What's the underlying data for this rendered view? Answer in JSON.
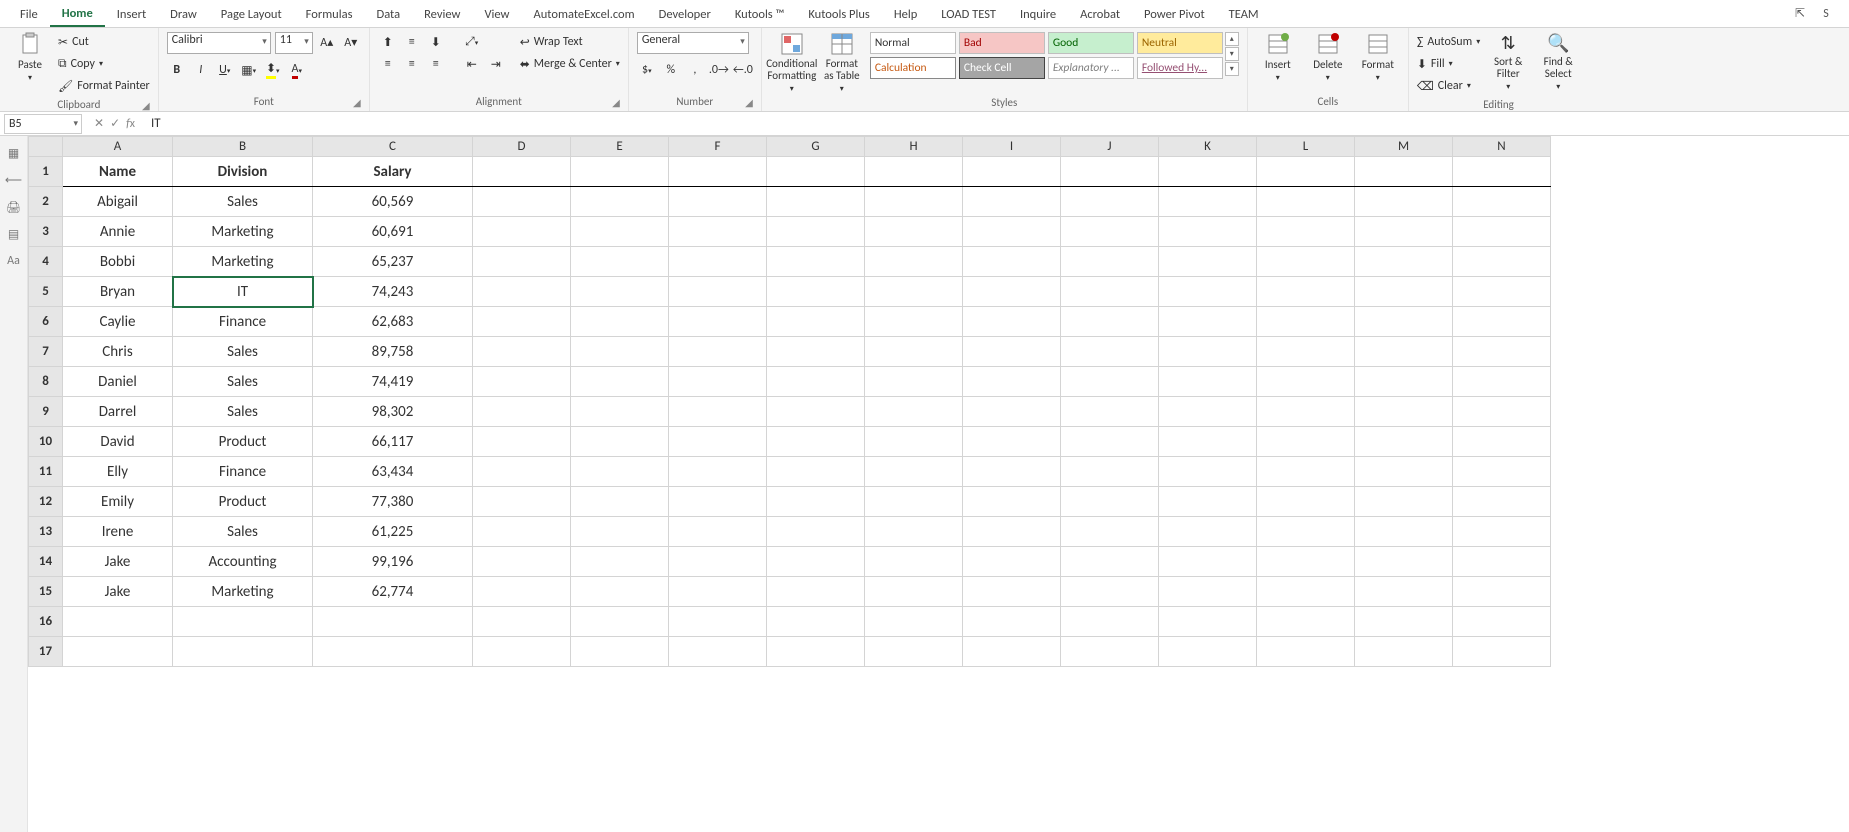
{
  "tabs": [
    "File",
    "Home",
    "Insert",
    "Draw",
    "Page Layout",
    "Formulas",
    "Data",
    "Review",
    "View",
    "AutomateExcel.com",
    "Developer",
    "Kutools ™",
    "Kutools Plus",
    "Help",
    "LOAD TEST",
    "Inquire",
    "Acrobat",
    "Power Pivot",
    "TEAM"
  ],
  "active_tab": "Home",
  "clipboard": {
    "cut": "Cut",
    "copy": "Copy",
    "paint": "Format Painter",
    "paste": "Paste",
    "label": "Clipboard"
  },
  "font": {
    "name": "Calibri",
    "size": "11",
    "label": "Font"
  },
  "alignment": {
    "wrap": "Wrap Text",
    "merge": "Merge & Center",
    "label": "Alignment"
  },
  "number": {
    "format": "General",
    "label": "Number"
  },
  "styles": {
    "cond": "Conditional Formatting",
    "fat": "Format as Table",
    "items": [
      "Normal",
      "Bad",
      "Good",
      "Neutral",
      "Calculation",
      "Check Cell",
      "Explanatory ...",
      "Followed Hy..."
    ],
    "label": "Styles"
  },
  "cells": {
    "insert": "Insert",
    "delete": "Delete",
    "format": "Format",
    "label": "Cells"
  },
  "editing": {
    "autosum": "AutoSum",
    "fill": "Fill",
    "clear": "Clear",
    "sort": "Sort & Filter",
    "find": "Find & Select",
    "label": "Editing"
  },
  "namebox": "B5",
  "formula": "IT",
  "columns": [
    "A",
    "B",
    "C",
    "D",
    "E",
    "F",
    "G",
    "H",
    "I",
    "J",
    "K",
    "L",
    "M",
    "N"
  ],
  "selected_cell": {
    "row": 5,
    "col": "B"
  },
  "rows": [
    {
      "n": 1,
      "A": "Name",
      "B": "Division",
      "C": "Salary",
      "hd": true
    },
    {
      "n": 2,
      "A": "Abigail",
      "B": "Sales",
      "C": "60,569"
    },
    {
      "n": 3,
      "A": "Annie",
      "B": "Marketing",
      "C": "60,691"
    },
    {
      "n": 4,
      "A": "Bobbi",
      "B": "Marketing",
      "C": "65,237"
    },
    {
      "n": 5,
      "A": "Bryan",
      "B": "IT",
      "C": "74,243"
    },
    {
      "n": 6,
      "A": "Caylie",
      "B": "Finance",
      "C": "62,683"
    },
    {
      "n": 7,
      "A": "Chris",
      "B": "Sales",
      "C": "89,758"
    },
    {
      "n": 8,
      "A": "Daniel",
      "B": "Sales",
      "C": "74,419"
    },
    {
      "n": 9,
      "A": "Darrel",
      "B": "Sales",
      "C": "98,302"
    },
    {
      "n": 10,
      "A": "David",
      "B": "Product",
      "C": "66,117"
    },
    {
      "n": 11,
      "A": "Elly",
      "B": "Finance",
      "C": "63,434"
    },
    {
      "n": 12,
      "A": "Emily",
      "B": "Product",
      "C": "77,380"
    },
    {
      "n": 13,
      "A": "Irene",
      "B": "Sales",
      "C": "61,225"
    },
    {
      "n": 14,
      "A": "Jake",
      "B": "Accounting",
      "C": "99,196"
    },
    {
      "n": 15,
      "A": "Jake",
      "B": "Marketing",
      "C": "62,774"
    },
    {
      "n": 16,
      "A": "",
      "B": "",
      "C": ""
    },
    {
      "n": 17,
      "A": "",
      "B": "",
      "C": ""
    }
  ]
}
